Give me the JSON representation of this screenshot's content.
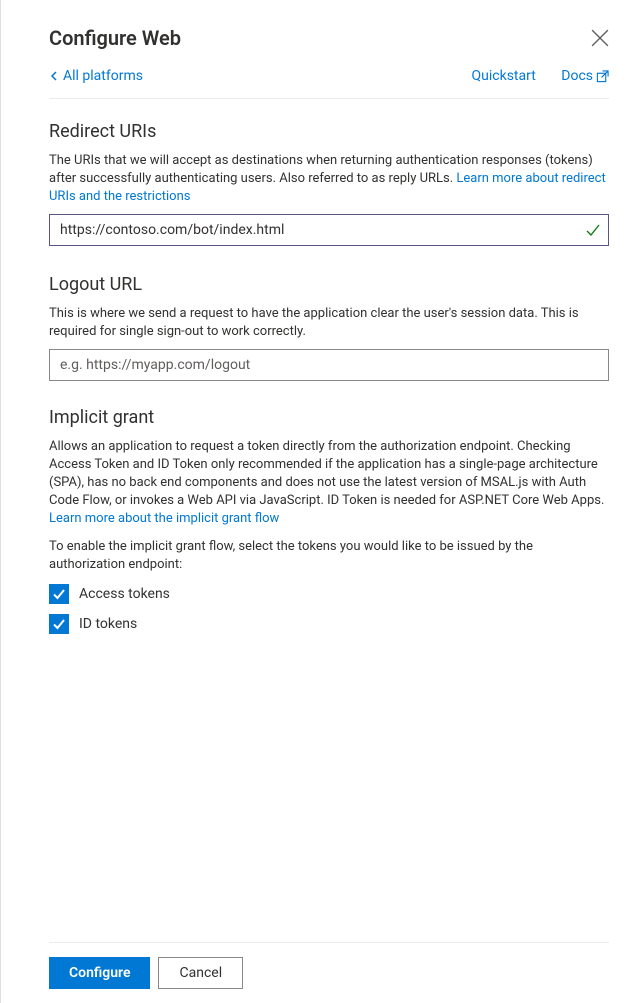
{
  "header": {
    "title": "Configure Web"
  },
  "topLinks": {
    "back": "All platforms",
    "quickstart": "Quickstart",
    "docs": "Docs"
  },
  "redirect": {
    "title": "Redirect URIs",
    "desc_prefix": "The URIs that we will accept as destinations when returning authentication responses (tokens) after successfully authenticating users. Also referred to as reply URLs. ",
    "link": "Learn more about redirect URIs and the restrictions",
    "value": "https://contoso.com/bot/index.html"
  },
  "logout": {
    "title": "Logout URL",
    "desc": "This is where we send a request to have the application clear the user's session data. This is required for single sign-out to work correctly.",
    "placeholder": "e.g. https://myapp.com/logout",
    "value": ""
  },
  "implicit": {
    "title": "Implicit grant",
    "desc_prefix": "Allows an application to request a token directly from the authorization endpoint. Checking Access Token and ID Token only recommended if the application has a single-page architecture (SPA), has no back end components and does not use the latest version of MSAL.js with Auth Code Flow, or invokes a Web API via JavaScript. ID Token is needed for ASP.NET Core Web Apps. ",
    "link": "Learn more about the implicit grant flow",
    "enable_note": "To enable the implicit grant flow, select the tokens you would like to be issued by the authorization endpoint:",
    "access_tokens_label": "Access tokens",
    "id_tokens_label": "ID tokens",
    "access_tokens_checked": true,
    "id_tokens_checked": true
  },
  "footer": {
    "configure": "Configure",
    "cancel": "Cancel"
  }
}
